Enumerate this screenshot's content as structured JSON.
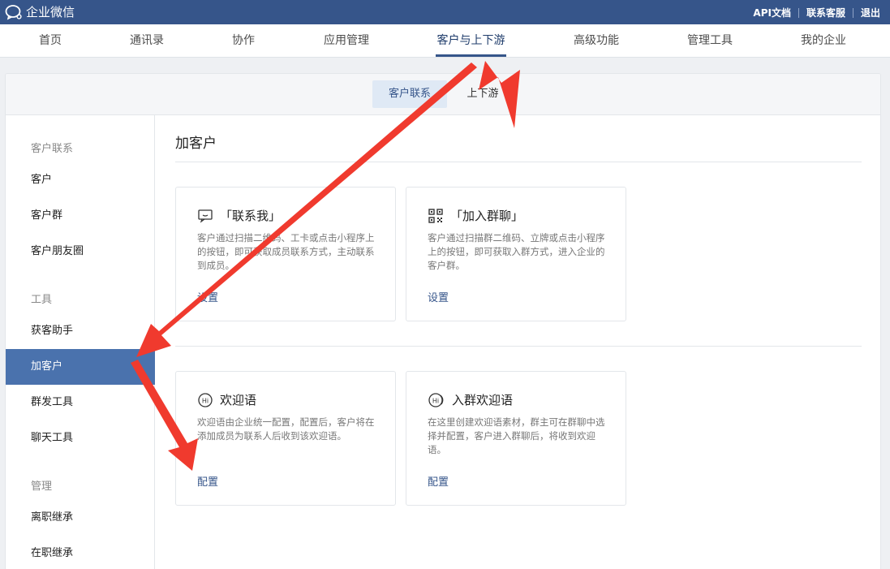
{
  "brand": {
    "name": "企业微信",
    "logo_icon": "wechat-work-icon"
  },
  "top_links": [
    "API文档",
    "联系客服",
    "退出"
  ],
  "main_nav": [
    "首页",
    "通讯录",
    "协作",
    "应用管理",
    "客户与上下游",
    "高级功能",
    "管理工具",
    "我的企业"
  ],
  "main_nav_active": "客户与上下游",
  "sub_tabs": [
    "客户联系",
    "上下游"
  ],
  "sub_tab_active": "客户联系",
  "sidebar": {
    "groups": [
      {
        "title": "客户联系",
        "items": [
          "客户",
          "客户群",
          "客户朋友圈"
        ]
      },
      {
        "title": "工具",
        "items": [
          "获客助手",
          "加客户",
          "群发工具",
          "聊天工具"
        ]
      },
      {
        "title": "管理",
        "items": [
          "离职继承",
          "在职继承"
        ]
      }
    ],
    "active": "加客户"
  },
  "page_title": "加客户",
  "cards": [
    {
      "title": "「联系我」",
      "icon": "chat-bubble-icon",
      "desc": "客户通过扫描二维码、工卡或点击小程序上的按钮，即可获取成员联系方式，主动联系到成员。",
      "link": "设置"
    },
    {
      "title": "「加入群聊」",
      "icon": "qr-code-icon",
      "desc": "客户通过扫描群二维码、立牌或点击小程序上的按钮，即可获取入群方式，进入企业的客户群。",
      "link": "设置"
    },
    {
      "title": "欢迎语",
      "icon": "hi-bubble-icon",
      "desc": "欢迎语由企业统一配置，配置后，客户将在添加成员为联系人后收到该欢迎语。",
      "link": "配置"
    },
    {
      "title": "入群欢迎语",
      "icon": "hi-group-bubble-icon",
      "desc": "在这里创建欢迎语素材，群主可在群聊中选择并配置，客户进入群聊后，将收到欢迎语。",
      "link": "配置"
    }
  ],
  "colors": {
    "topbar": "#36558a",
    "accent": "#4a72ad",
    "annotation_arrow": "#f03a2e"
  }
}
